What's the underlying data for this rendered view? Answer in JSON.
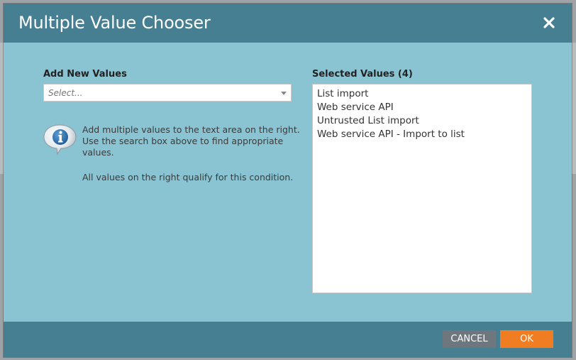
{
  "dialog": {
    "title": "Multiple Value Chooser",
    "close_icon": "close-icon"
  },
  "left": {
    "label": "Add New Values",
    "select_placeholder": "Select...",
    "info_icon": "info-icon",
    "help_line1": "Add multiple values to the text area on the right. Use the search box above to find appropriate values.",
    "help_line2": "All values on the right qualify for this condition."
  },
  "right": {
    "label": "Selected Values (4)",
    "values": [
      "List import",
      "Web service API",
      "Untrusted List import",
      "Web service API - Import to list"
    ]
  },
  "footer": {
    "cancel_label": "CANCEL",
    "ok_label": "OK"
  },
  "colors": {
    "header": "#467f92",
    "body": "#8ac4d2",
    "ok": "#f07d22",
    "cancel": "#6d777d"
  }
}
